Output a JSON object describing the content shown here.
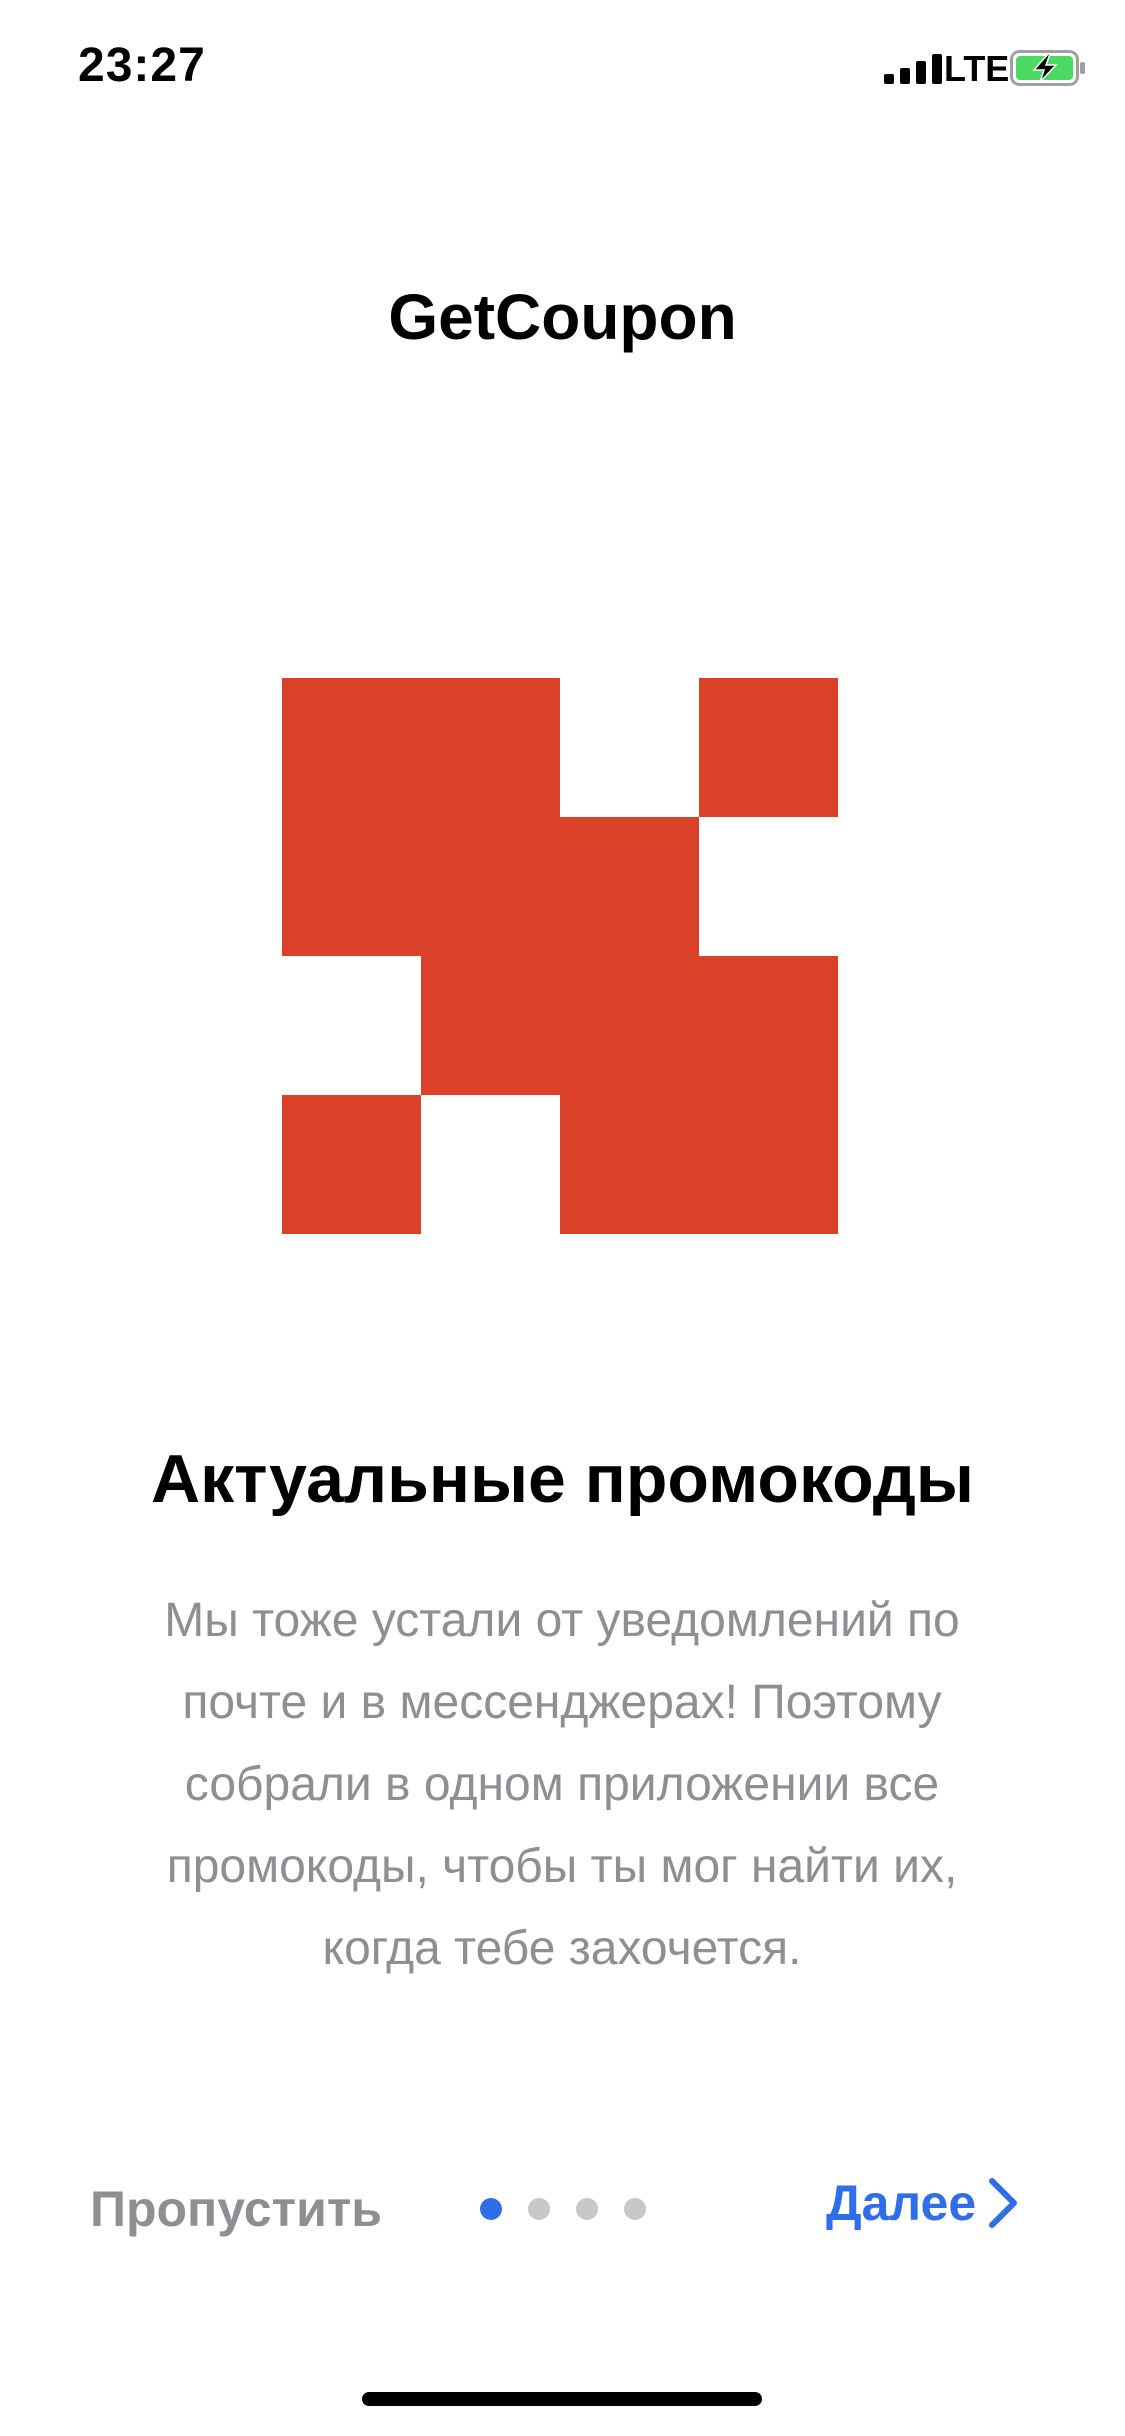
{
  "status_bar": {
    "time": "23:27",
    "network": "LTE",
    "icons": {
      "signal": "signal-icon",
      "battery": "battery-charging-icon"
    }
  },
  "app": {
    "title": "GetCoupon"
  },
  "logo": {
    "icon": "getcoupon-logo-icon",
    "color": "#db4029"
  },
  "onboarding": {
    "headline": "Актуальные промокоды",
    "description": "Мы тоже устали от уведомлений по почте и в мессенджерах! Поэтому собрали в одном приложении все промокоды, чтобы ты мог найти их, когда тебе захочется.",
    "page_current": 1,
    "page_total": 4
  },
  "controls": {
    "skip_label": "Пропустить",
    "next_label": "Далее",
    "next_icon": "chevron-right-icon"
  },
  "colors": {
    "accent": "#2f6ee8",
    "muted_text": "#8e8e93",
    "dot_inactive": "#c7c7cc",
    "battery_fill": "#4cd964"
  }
}
